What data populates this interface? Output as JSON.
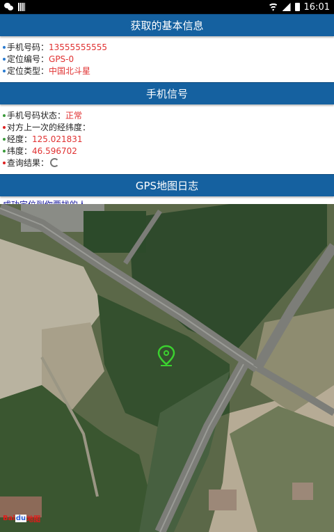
{
  "status_bar": {
    "time": "16:01"
  },
  "section1": {
    "title": "获取的基本信息",
    "rows": [
      {
        "label": "手机号码：",
        "value": "13555555555"
      },
      {
        "label": "定位编号：",
        "value": "GPS-0"
      },
      {
        "label": "定位类型：",
        "value": "中国北斗星"
      }
    ]
  },
  "section2": {
    "title": "手机信号",
    "status_label": "手机号码状态：",
    "status_value": "正常",
    "last_coords_label": "对方上一次的经纬度：",
    "lng_label": "经度：",
    "lng_value": "125.021831",
    "lat_label": "纬度：",
    "lat_value": "46.596702",
    "query_label": "查询结果："
  },
  "section3": {
    "title": "GPS地图日志",
    "note": "成功定位到你要找的人"
  },
  "map": {
    "logo": [
      "Bai",
      "du",
      "地图"
    ],
    "marker_color": "#3bd12f"
  },
  "colors": {
    "header_bg": "#1561a0",
    "value_red": "#e03030",
    "note_blue": "#1a1aa0"
  }
}
